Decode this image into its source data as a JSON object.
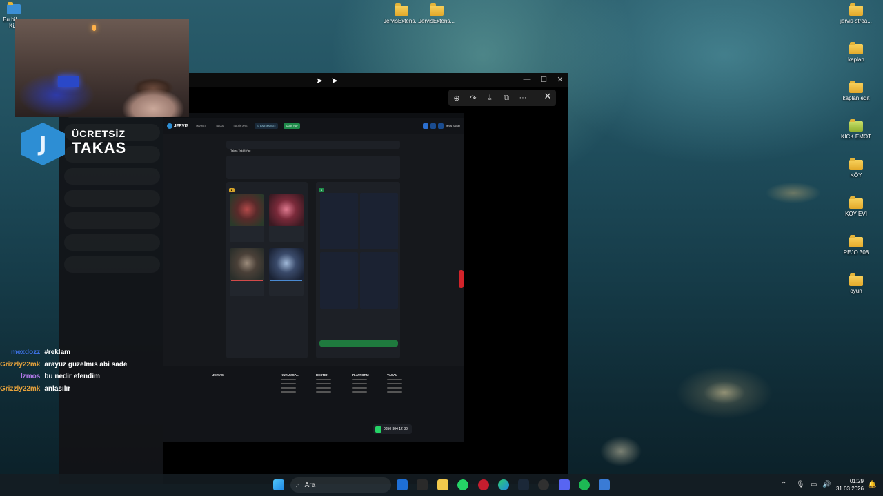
{
  "desktop": {
    "icons_top_center": [
      {
        "label": "JervisExtens..."
      },
      {
        "label": "JervisExtens..."
      }
    ],
    "icons_right": [
      {
        "label": "jervis-strea..."
      },
      {
        "label": "kaplan"
      },
      {
        "label": "kaplan edit"
      },
      {
        "label": "KICK EMOT"
      },
      {
        "label": "KÖY"
      },
      {
        "label": "KÖY EVİ"
      },
      {
        "label": "PEJO 308"
      },
      {
        "label": "oyun"
      }
    ],
    "icon_topleft_label": "Bu bil... - Ki..."
  },
  "overlay": {
    "brand_top": "ÜCRETSİZ",
    "brand_bottom": "TAKAS",
    "badge_letter": "J"
  },
  "chat": [
    {
      "user": "mexdozz",
      "message": "#reklam",
      "color": "#3b6fe0"
    },
    {
      "user": "Grizzly22mk",
      "message": "arayüz guzelmıs abi sade",
      "color": "#e6a23c"
    },
    {
      "user": "lzmos",
      "message": "bu nedir efendim",
      "color": "#b078e8"
    },
    {
      "user": "Grizzly22mk",
      "message": "anlasılır",
      "color": "#e6a23c"
    }
  ],
  "photo_viewer": {
    "toolbar": [
      "zoom-in",
      "rotate",
      "save",
      "share",
      "more"
    ],
    "close": "✕"
  },
  "site": {
    "logo": "JERVIS",
    "nav": [
      "MARKET",
      "TAKAS",
      "TAKSİR ARŞ",
      "STEAM MARKET",
      "SATIŞ YAP"
    ],
    "user": "Jervis Kaplan",
    "page_title": "Takas Teklifi Yap",
    "footer": {
      "logo": "JERVIS",
      "columns": [
        "KURUMSAL",
        "DESTEK",
        "PLATFORM",
        "YASAL"
      ],
      "phone": "0850 304 12 88"
    }
  },
  "taskbar": {
    "search_placeholder": "Ara",
    "time": "01:29",
    "date": "31.03.2026"
  }
}
